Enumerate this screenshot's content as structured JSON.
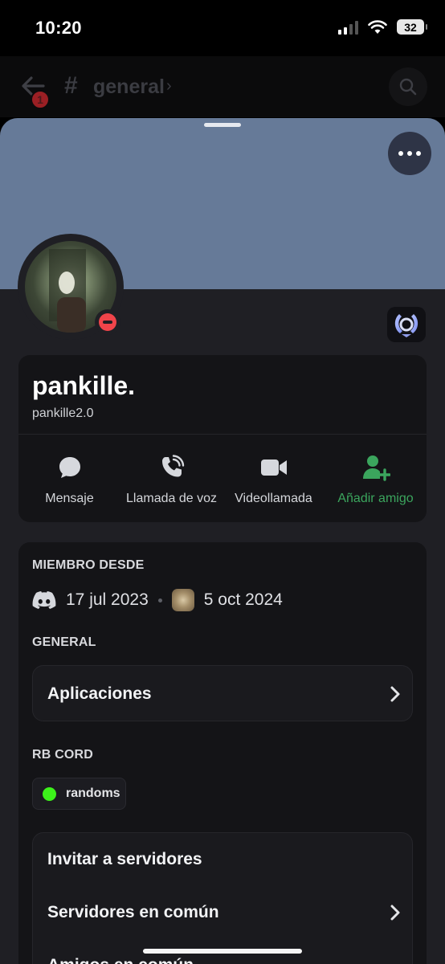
{
  "status_bar": {
    "time": "10:20",
    "battery": "32",
    "icons": [
      "cellular-signal-icon",
      "wifi-icon",
      "battery-icon"
    ]
  },
  "channel_header": {
    "back_badge": "1",
    "hash": "#",
    "channel_name": "general",
    "chevron": "›",
    "icons": [
      "back-arrow-icon",
      "search-icon"
    ]
  },
  "profile": {
    "banner_color": "#667a98",
    "status": "do-not-disturb",
    "status_color": "#f0444a",
    "display_name": "pankille.",
    "username": "pankille2.0",
    "badge_icon": "nitro-laurel-icon",
    "more_icon": "more-options-icon"
  },
  "actions": [
    {
      "label": "Mensaje",
      "icon": "message-icon"
    },
    {
      "label": "Llamada de voz",
      "icon": "voice-call-icon"
    },
    {
      "label": "Videollamada",
      "icon": "video-call-icon"
    },
    {
      "label": "Añadir amigo",
      "icon": "add-friend-icon",
      "color": "#3ba55d"
    }
  ],
  "member_since": {
    "title": "MIEMBRO DESDE",
    "discord_date": "17 jul 2023",
    "server_date": "5 oct 2024"
  },
  "general": {
    "title": "GENERAL",
    "apps_label": "Aplicaciones"
  },
  "server_roles": {
    "title": "RB CORD",
    "role_name": "randoms",
    "role_color": "#3cf21a"
  },
  "list": {
    "items": [
      "Invitar a servidores",
      "Servidores en común",
      "Amigos en común"
    ]
  }
}
